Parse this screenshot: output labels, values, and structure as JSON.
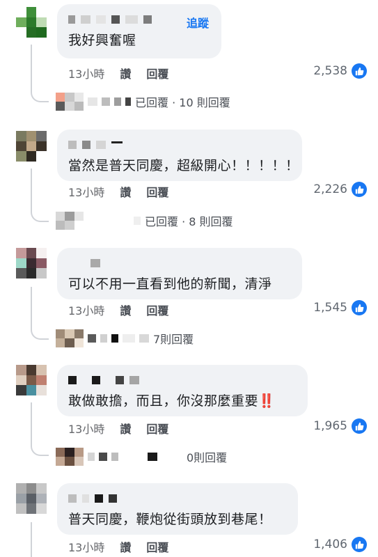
{
  "comments": [
    {
      "text": "我好興奮喔",
      "follow_label": "追蹤",
      "time": "13小時",
      "like_label": "讚",
      "reply_label": "回覆",
      "likes": "2,538",
      "replies_text": "已回覆 · 10 則回覆"
    },
    {
      "text": "當然是普天同慶，超級開心！！！！！",
      "time": "13小時",
      "like_label": "讚",
      "reply_label": "回覆",
      "likes": "2,226",
      "replies_text": "已回覆 · 8 則回覆"
    },
    {
      "text": "可以不用一直看到他的新聞，清淨",
      "time": "13小時",
      "like_label": "讚",
      "reply_label": "回覆",
      "likes": "1,545",
      "replies_text": "7則回覆"
    },
    {
      "text": "敢做敢擔，而且，你沒那麼重要",
      "time": "13小時",
      "like_label": "讚",
      "reply_label": "回覆",
      "likes": "1,965",
      "replies_text": "0則回覆",
      "emoji": "‼️"
    },
    {
      "text": "普天同慶，鞭炮從街頭放到巷尾！",
      "time": "13小時",
      "like_label": "讚",
      "reply_label": "回覆",
      "likes": "1,406"
    }
  ],
  "colors": {
    "bubble": "#f0f2f5",
    "link": "#1877f2",
    "meta": "#65676b",
    "like_badge": "#1877f2"
  },
  "icons": {
    "like": "thumbs-up-icon"
  }
}
